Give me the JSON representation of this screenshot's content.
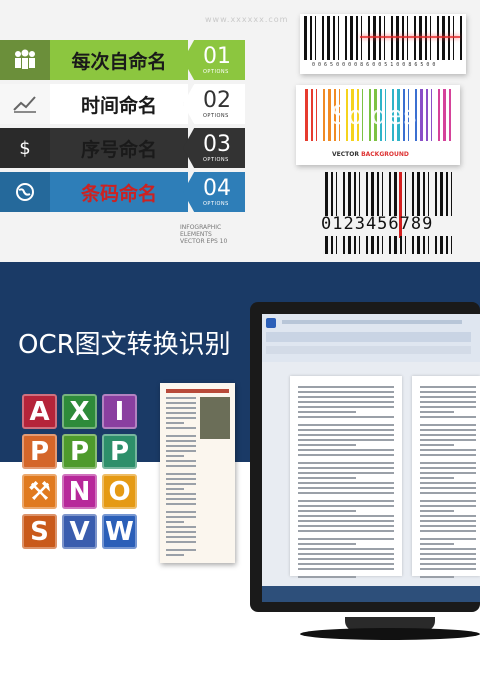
{
  "watermark": "www.xxxxxx.com",
  "naming_options": [
    {
      "label": "每次自命名",
      "num": "01",
      "tag": "OPTIONS",
      "icon": "people-icon",
      "label_color": "#1a1a1a",
      "color": "#8cc63f",
      "opt_color": "#8cc63f",
      "opt_text": "#ffffff"
    },
    {
      "label": "时间命名",
      "num": "02",
      "tag": "OPTIONS",
      "icon": "trend-chart-icon",
      "label_color": "#1a1a1a",
      "color": "#ffffff",
      "opt_color": "#ffffff",
      "opt_text": "#333333"
    },
    {
      "label": "序号命名",
      "num": "03",
      "tag": "OPTIONS",
      "icon": "dollar-icon",
      "label_color": "#1a1a1a",
      "color": "#333333",
      "opt_color": "#333333",
      "opt_text": "#ffffff"
    },
    {
      "label": "条码命名",
      "num": "04",
      "tag": "OPTIONS",
      "icon": "globe-icon",
      "label_color": "#cc2222",
      "color": "#2e7eb8",
      "opt_color": "#2e7eb8",
      "opt_text": "#ffffff"
    }
  ],
  "infographic_note": [
    "INFOGRAPHIC",
    "ELEMENTS",
    "VECTOR  EPS 10"
  ],
  "barcode_top_digits": "0 0 6 5 0 0 0 0 8 6    0 0 5 1    0 0 8 6 5 0 0",
  "barcode_brand": "Soides",
  "barcode_caption_a": "VECTOR",
  "barcode_caption_b": "BACKGROUND",
  "barcode_digits": "0123456789",
  "ocr_title": "OCR图文转换识别",
  "office_apps": [
    {
      "letter": "A",
      "color": "#b5243a"
    },
    {
      "letter": "X",
      "color": "#2e8b3a"
    },
    {
      "letter": "I",
      "color": "#8a3fa0"
    },
    {
      "letter": "P",
      "color": "#d4662a"
    },
    {
      "letter": "P",
      "color": "#4e9a2c"
    },
    {
      "letter": "P",
      "color": "#2d8f6a"
    },
    {
      "letter": "⚒",
      "color": "#e07a1f"
    },
    {
      "letter": "N",
      "color": "#b7289a"
    },
    {
      "letter": "O",
      "color": "#e59a14"
    },
    {
      "letter": "S",
      "color": "#c95a1b"
    },
    {
      "letter": "V",
      "color": "#3a5dae"
    },
    {
      "letter": "W",
      "color": "#2b5fb8"
    }
  ],
  "colors": {
    "navy": "#1a3a66",
    "accent_red": "#cc2222"
  }
}
